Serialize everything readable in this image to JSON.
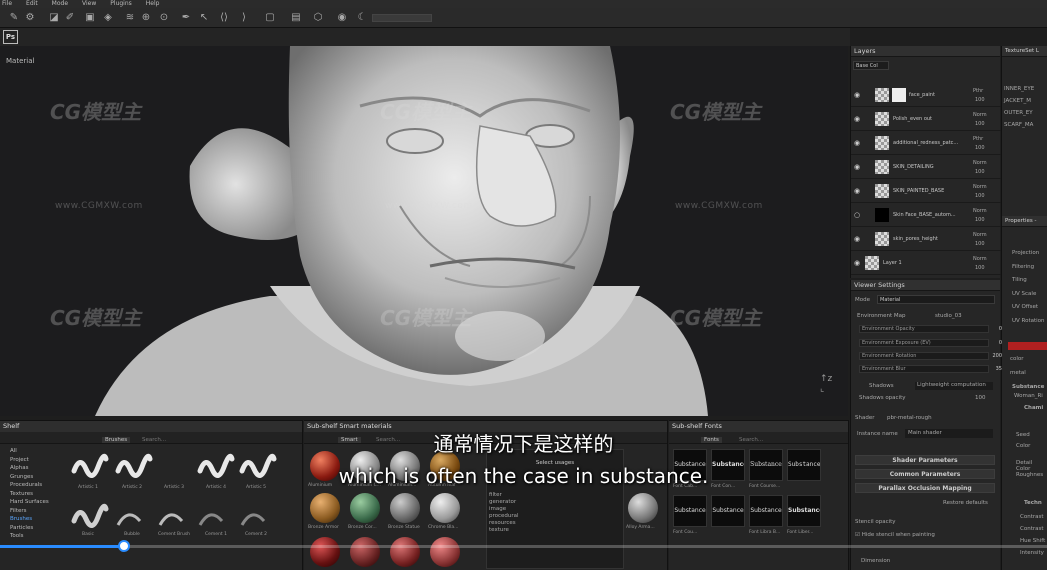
{
  "menu": [
    "File",
    "Edit",
    "Mode",
    "View",
    "Plugins",
    "Help"
  ],
  "toolbar_icons": [
    "paint-brush",
    "eraser",
    "projection",
    "polyfill",
    "smudge",
    "clone",
    "picker",
    "symmetry",
    "camera",
    "environment",
    "render"
  ],
  "ps_button": "Ps",
  "viewport": {
    "label": "Material"
  },
  "watermark": {
    "brand": "CG模型主",
    "url": "www.CGMXW.com"
  },
  "layers": {
    "title": "Layers",
    "blend_dropdown": "Base Col",
    "rows": [
      {
        "name": "face_paint",
        "blend": "Pthr",
        "opacity": "100"
      },
      {
        "name": "Polish_even out",
        "blend": "Norm",
        "opacity": "100"
      },
      {
        "name": "additional_redness_patc...",
        "blend": "Pthr",
        "opacity": "100"
      },
      {
        "name": "SKIN_DETAILING",
        "blend": "Norm",
        "opacity": "100"
      },
      {
        "name": "SKIN_PAINTED_BASE",
        "blend": "Norm",
        "opacity": "100"
      },
      {
        "name": "Skin Face_BASE_autom...",
        "blend": "Norm",
        "opacity": "100"
      },
      {
        "name": "skin_pores_height",
        "blend": "Norm",
        "opacity": "100"
      },
      {
        "name": "Layer 1",
        "blend": "Norm",
        "opacity": "100"
      }
    ]
  },
  "texture_set_list": {
    "title": "TextureSet L",
    "items": [
      "INNER_EYE",
      "JACKET_M",
      "OUTER_EY",
      "SCARF_MA"
    ]
  },
  "properties": {
    "title": "Properties - ",
    "fields": [
      "Projection",
      "Filtering",
      "Tiling",
      "UV Scale",
      "UV Offset",
      "UV Rotation"
    ],
    "color_label": "color",
    "metal_label": "metal",
    "substance_label": "Substance",
    "substance_value": "Woman_Ri",
    "cham_label": "Chami",
    "seed_label": "Seed",
    "color2_label": "Color",
    "detail_label": "Detail Color",
    "rough_label": "Roughnes",
    "tech_label": "Techn",
    "tech_items": [
      "Contrast",
      "Contrast",
      "Hue Shift",
      "Intensity"
    ]
  },
  "viewer_settings": {
    "title": "Viewer Settings",
    "mode_label": "Mode",
    "mode_value": "Material",
    "env_map_label": "Environment Map",
    "env_map_value": "studio_03",
    "rows": [
      {
        "label": "Environment Opacity",
        "value": "0"
      },
      {
        "label": "Environment Exposure (EV)",
        "value": "0"
      },
      {
        "label": "Environment Rotation",
        "value": "200"
      },
      {
        "label": "Environment Blur",
        "value": "35"
      }
    ],
    "shadows_label": "Shadows",
    "shadows_value": "Lightweight computation",
    "shadows_opacity_label": "Shadows opacity",
    "shadows_opacity_value": "100",
    "shader_label": "Shader",
    "shader_value": "pbr-metal-rough",
    "instance_label": "Instance name",
    "instance_value": "Main shader",
    "groups": [
      "Shader Parameters",
      "Common Parameters",
      "Parallax Occlusion Mapping"
    ],
    "restore_button": "Restore defaults",
    "stencil_label": "Stencil opacity",
    "hide_stencil_label": "Hide stencil when painting",
    "dimension_label": "Dimension"
  },
  "shelf": {
    "title": "Shelf",
    "tab": "Brushes",
    "search_placeholder": "Search...",
    "categories": [
      "All",
      "Project",
      "Alphas",
      "Grunges",
      "Procedurals",
      "Textures",
      "Hard Surfaces",
      "Filters",
      "Brushes",
      "Particles",
      "Tools"
    ],
    "selected_category": "Brushes",
    "brushes": [
      "Artistic 1",
      "Artistic 2",
      "Artistic 3",
      "Artistic 4",
      "Artistic 5",
      "Basic",
      "Bubble",
      "Cement Brush",
      "Cement 1",
      "Cement 2"
    ]
  },
  "smart_materials": {
    "title": "Sub-shelf Smart materials",
    "tab": "Smart",
    "search_placeholder": "Search...",
    "items": [
      "Aluminium",
      "Aluminium C...",
      "Aluminium...",
      "Autumn leaf",
      "Bronze Armor",
      "Bronze Cor...",
      "Bronze Statue",
      "Chrome Bla..."
    ],
    "select_usages_title": "Select usages",
    "usages": [
      "filter",
      "generator",
      "image",
      "procedural",
      "resources",
      "texture"
    ],
    "extra_items": [
      "Alloy Arma..."
    ]
  },
  "fonts_panel": {
    "title": "Sub-shelf Fonts",
    "tab": "Fonts",
    "search_placeholder": "Search...",
    "tiles": [
      "Substance",
      "Substance",
      "Substance",
      "Substance",
      "Substance",
      "Substance",
      "Substance",
      "Substance"
    ],
    "labels": [
      "Font Cab...",
      "Font Con...",
      "Font Course...",
      "Font Cou...",
      "Font Libra B...",
      "Font Liber..."
    ]
  },
  "subtitle": {
    "cn": "通常情况下是这样的",
    "en": "which is often the case in substance."
  },
  "progress": {
    "fraction": 0.118
  }
}
